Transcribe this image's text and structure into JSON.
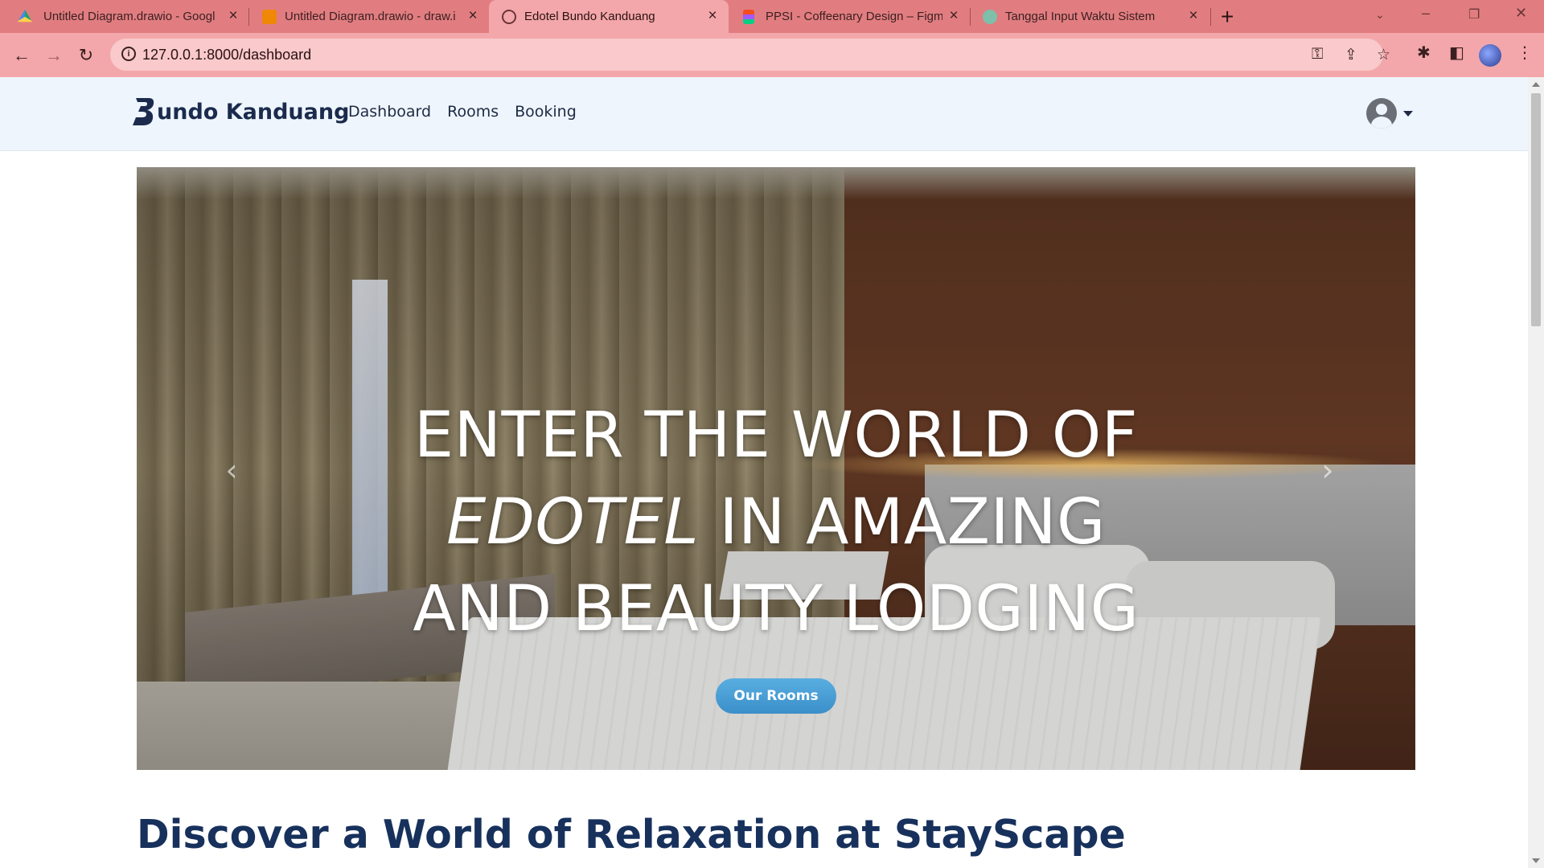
{
  "browser": {
    "tabs": [
      {
        "title": "Untitled Diagram.drawio - Googl",
        "icon": "google-drive-icon",
        "active": false
      },
      {
        "title": "Untitled Diagram.drawio - draw.i",
        "icon": "drawio-icon",
        "active": false
      },
      {
        "title": "Edotel Bundo Kanduang",
        "icon": "globe-icon",
        "active": true
      },
      {
        "title": "PPSI - Coffeenary Design – Figm",
        "icon": "figma-icon",
        "active": false
      },
      {
        "title": "Tanggal Input Waktu Sistem",
        "icon": "chatgpt-icon",
        "active": false
      }
    ],
    "url": "127.0.0.1:8000/dashboard",
    "chrome_color": "#e17d80",
    "toolbar_color": "#f3a7aa"
  },
  "site": {
    "brand": "undo Kanduang",
    "nav": [
      "Dashboard",
      "Rooms",
      "Booking"
    ]
  },
  "hero": {
    "line1": "ENTER THE WORLD OF",
    "line2_italic": "EDOTEL",
    "line2_rest": " IN AMAZING",
    "line3": "AND BEAUTY LODGING",
    "cta": "Our Rooms",
    "prev_label": "‹",
    "next_label": "›"
  },
  "section": {
    "title": "Discover a World of Relaxation at StayScape"
  },
  "colors": {
    "brand_navy": "#17315c",
    "cta_blue": "#4aa0d8"
  }
}
